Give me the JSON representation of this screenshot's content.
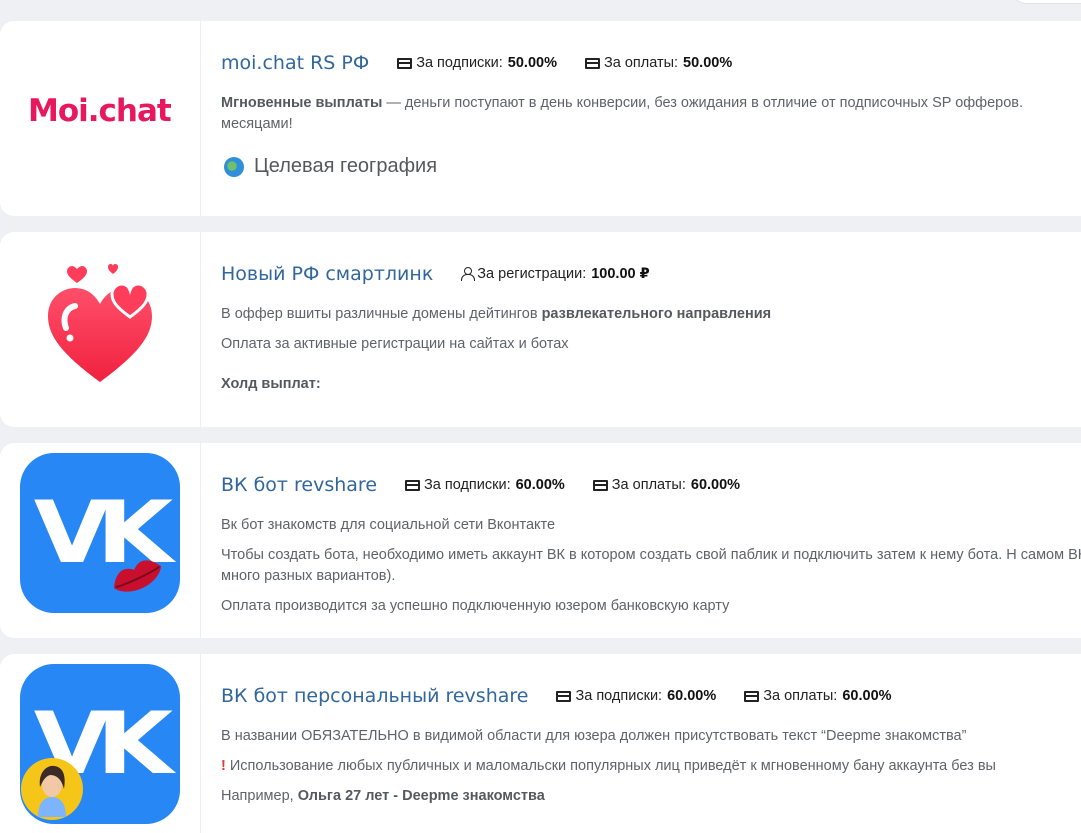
{
  "offers": [
    {
      "logo_text": "Moi.chat",
      "title": "moi.chat RS РФ",
      "rates": [
        {
          "icon": "credit-card-icon",
          "label": "За подписки:",
          "value": "50.00%"
        },
        {
          "icon": "credit-card-icon",
          "label": "За оплаты:",
          "value": "50.00%"
        }
      ],
      "desc_bold": "Мгновенные выплаты",
      "desc_rest": " — деньги поступают в день конверсии, без ожидания в отличие от подписочных SP офферов. месяцами!",
      "geo_label": "Целевая география"
    },
    {
      "title": "Новый РФ смартлинк",
      "rates": [
        {
          "icon": "user-icon",
          "label": "За регистрации:",
          "value": "100.00 ₽"
        }
      ],
      "line1_plain": "В оффер вшиты различные домены  дейтингов ",
      "line1_bold": "развлекательного направления",
      "line2": "Оплата за активные регистрации на сайтах и ботах",
      "line3_bold": "Холд выплат:"
    },
    {
      "title": "ВК бот revshare",
      "rates": [
        {
          "icon": "credit-card-icon",
          "label": "За подписки:",
          "value": "60.00%"
        },
        {
          "icon": "credit-card-icon",
          "label": "За оплаты:",
          "value": "60.00%"
        }
      ],
      "line1": "Вк бот знакомств для социальной сети Вконтакте",
      "line2": "Чтобы создать бота, необходимо иметь аккаунт ВК в котором создать свой паблик и подключить затем к нему бота. Н самом ВК много разных вариантов).",
      "line3": "Оплата производится за успешно подключенную юзером банковскую карту"
    },
    {
      "title": "ВК бот персональный revshare",
      "rates": [
        {
          "icon": "credit-card-icon",
          "label": "За подписки:",
          "value": "60.00%"
        },
        {
          "icon": "credit-card-icon",
          "label": "За оплаты:",
          "value": "60.00%"
        }
      ],
      "line1": " В названии ОБЯЗАТЕЛЬНО в видимой области для юзера должен присутствовать текст “Deepme знакомства”",
      "line2": "Использование любых публичных и маломальски популярных лиц  приведёт к мгновенному бану аккаунта без вы",
      "line3_plain": "Например, ",
      "line3_bold": "Ольга 27 лет - Deepme знакомства"
    }
  ]
}
